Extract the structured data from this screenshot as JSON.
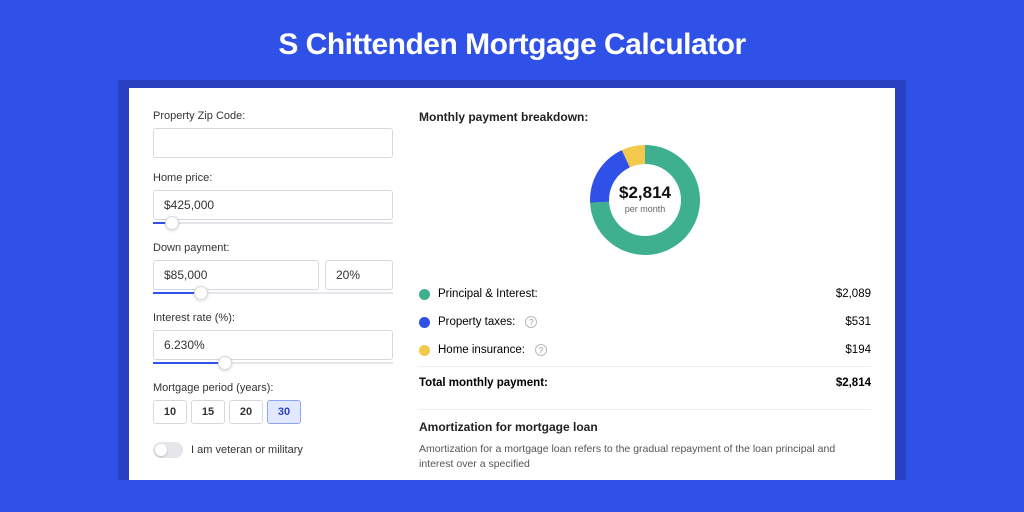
{
  "title": "S Chittenden Mortgage Calculator",
  "colors": {
    "primary": "#3051e8",
    "principal": "#3fb08f",
    "taxes": "#3051e8",
    "insurance": "#f2c94c"
  },
  "form": {
    "zip": {
      "label": "Property Zip Code:",
      "value": ""
    },
    "home_price": {
      "label": "Home price:",
      "value": "$425,000",
      "slider_pct": 8
    },
    "down_payment": {
      "label": "Down payment:",
      "amount": "$85,000",
      "percent": "20%",
      "slider_pct": 20
    },
    "interest": {
      "label": "Interest rate (%):",
      "value": "6.230%",
      "slider_pct": 30
    },
    "period": {
      "label": "Mortgage period (years):",
      "options": [
        "10",
        "15",
        "20",
        "30"
      ],
      "selected": "30"
    },
    "veteran": {
      "label": "I am veteran or military",
      "on": false
    }
  },
  "breakdown": {
    "title": "Monthly payment breakdown:",
    "total_amount": "$2,814",
    "total_label": "per month",
    "rows": [
      {
        "label": "Principal & Interest:",
        "value": "$2,089",
        "color": "#3fb08f",
        "info": false
      },
      {
        "label": "Property taxes:",
        "value": "$531",
        "color": "#3051e8",
        "info": true
      },
      {
        "label": "Home insurance:",
        "value": "$194",
        "color": "#f2c94c",
        "info": true
      }
    ],
    "total_row": {
      "label": "Total monthly payment:",
      "value": "$2,814"
    }
  },
  "amortization": {
    "title": "Amortization for mortgage loan",
    "text": "Amortization for a mortgage loan refers to the gradual repayment of the loan principal and interest over a specified"
  },
  "chart_data": {
    "type": "pie",
    "title": "Monthly payment breakdown",
    "center_value": "$2,814",
    "center_label": "per month",
    "series": [
      {
        "name": "Principal & Interest",
        "value": 2089,
        "color": "#3fb08f"
      },
      {
        "name": "Property taxes",
        "value": 531,
        "color": "#3051e8"
      },
      {
        "name": "Home insurance",
        "value": 194,
        "color": "#f2c94c"
      }
    ],
    "total": 2814
  }
}
